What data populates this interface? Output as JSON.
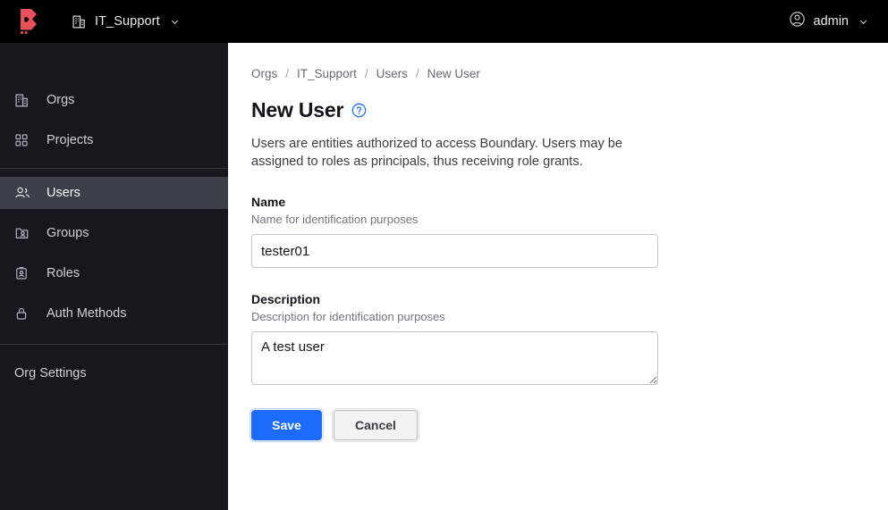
{
  "topbar": {
    "logo_name": "boundary-logo",
    "logo_color": "#e8505b",
    "org_icon": "building-icon",
    "org_name": "IT_Support",
    "org_caret_icon": "chevron-down-icon",
    "user_icon": "user-circle-icon",
    "user_name": "admin",
    "user_caret_icon": "chevron-down-icon",
    "background": "#000000"
  },
  "sidebar": {
    "background": "#16181d",
    "active_background": "#3b3f48",
    "items": [
      {
        "label": "Orgs",
        "icon": "building-icon",
        "active": false
      },
      {
        "label": "Projects",
        "icon": "grid-icon",
        "active": false
      },
      {
        "label": "Users",
        "icon": "users-icon",
        "active": true
      },
      {
        "label": "Groups",
        "icon": "folder-users-icon",
        "active": false
      },
      {
        "label": "Roles",
        "icon": "id-card-icon",
        "active": false
      },
      {
        "label": "Auth Methods",
        "icon": "lock-icon",
        "active": false
      }
    ],
    "settings_label": "Org Settings"
  },
  "breadcrumb": {
    "separator": "/",
    "items": [
      "Orgs",
      "IT_Support",
      "Users",
      "New User"
    ]
  },
  "page": {
    "title": "New User",
    "help_icon": "help-circle-icon",
    "help_icon_color": "#1c6bfb",
    "description": "Users are entities authorized to access Boundary. Users may be assigned to roles as principals, thus receiving role grants."
  },
  "form": {
    "name": {
      "label": "Name",
      "help": "Name for identification purposes",
      "value": "tester01",
      "placeholder": "Name"
    },
    "description": {
      "label": "Description",
      "help": "Description for identification purposes",
      "value": "A test user",
      "placeholder": "Description"
    }
  },
  "actions": {
    "save_label": "Save",
    "cancel_label": "Cancel",
    "save_color": "#1c6bfb",
    "cancel_color": "#f1f2f4"
  }
}
